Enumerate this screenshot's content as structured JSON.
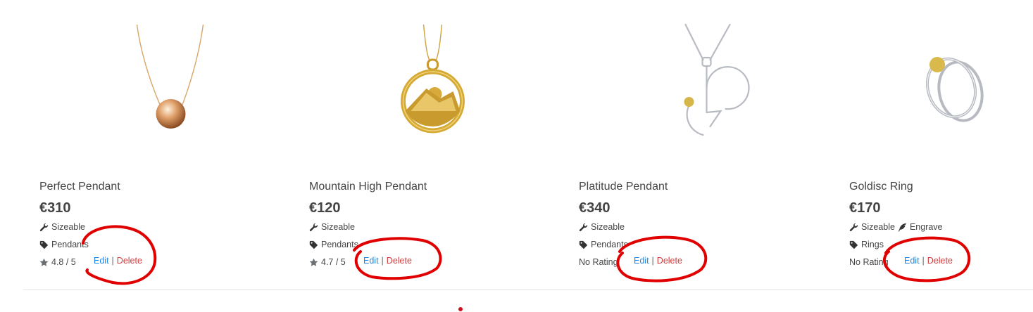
{
  "products": [
    {
      "name": "Perfect Pendant",
      "price": "€310",
      "feature1": "Sizeable",
      "category": "Pendants",
      "rating": "4.8 / 5",
      "edit_label": "Edit",
      "delete_label": "Delete",
      "separator": "|"
    },
    {
      "name": "Mountain High Pendant",
      "price": "€120",
      "feature1": "Sizeable",
      "category": "Pendants",
      "rating": "4.7 / 5",
      "edit_label": "Edit",
      "delete_label": "Delete",
      "separator": "|"
    },
    {
      "name": "Platitude Pendant",
      "price": "€340",
      "feature1": "Sizeable",
      "category": "Pendants",
      "rating": "No Rating",
      "edit_label": "Edit",
      "delete_label": "Delete",
      "separator": "|"
    },
    {
      "name": "Goldisc Ring",
      "price": "€170",
      "feature1": "Sizeable",
      "feature2": "Engrave",
      "category": "Rings",
      "rating": "No Rating",
      "edit_label": "Edit",
      "delete_label": "Delete",
      "separator": "|"
    }
  ],
  "icons": {
    "feature": "wrench-icon",
    "feature2": "feather-icon",
    "category": "tag-icon",
    "rating": "star-icon"
  },
  "colors": {
    "edit_link": "#1e88e5",
    "delete_link": "#d23b3b",
    "annotation": "#e00000",
    "pager_dot": "#d10f1f"
  }
}
